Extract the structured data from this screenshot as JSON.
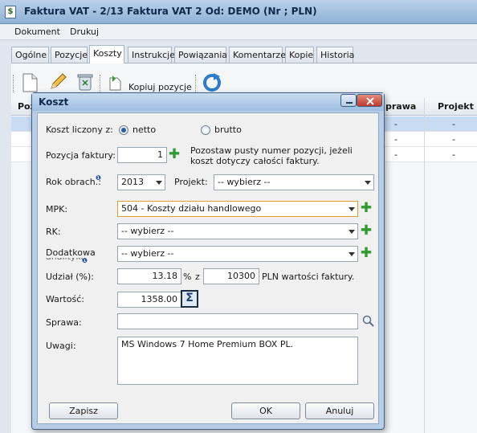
{
  "window": {
    "title": "Faktura VAT - 2/13 Faktura VAT 2 Od: DEMO (Nr ; PLN)"
  },
  "menu": [
    "Dokument",
    "Drukuj"
  ],
  "tabs": [
    "Ogólne",
    "Pozycje",
    "Koszty",
    "Instrukcje",
    "Powiązania",
    "Komentarze",
    "Kopie",
    "Historia"
  ],
  "toolbar": {
    "copy_label": "Kopiuj pozycje"
  },
  "grid": {
    "headers": {
      "first": "Poz",
      "sprawa": "prawa",
      "projekt": "Projekt"
    },
    "rows": [
      {
        "sprawa": "-",
        "projekt": "-"
      },
      {
        "sprawa": "-",
        "projekt": "-"
      },
      {
        "sprawa": "-",
        "projekt": "-"
      }
    ]
  },
  "dialog": {
    "title": "Koszt",
    "cost_basis_label": "Koszt liczony z:",
    "netto_label": "netto",
    "brutto_label": "brutto",
    "position_label": "Pozycja faktury:",
    "position_value": "1",
    "position_hint": "Pozostaw pusty numer pozycji, jeżeli koszt dotyczy całości faktury.",
    "year_label": "Rok obrach.:",
    "year_value": "2013",
    "project_label": "Projekt:",
    "project_value": "-- wybierz --",
    "mpk_label": "MPK:",
    "mpk_value": "504 - Koszty działu handlowego",
    "rk_label": "RK:",
    "rk_value": "-- wybierz --",
    "extra_label": "Dodatkowa",
    "extra_label2": "analityka",
    "extra_value": "-- wybierz --",
    "share_label": "Udział (%):",
    "share_value": "13.18",
    "percent_sign": "%",
    "of_label": "z",
    "total_value": "10300",
    "total_suffix": "PLN wartości faktury.",
    "amount_label": "Wartość:",
    "amount_value": "1358.00",
    "case_label": "Sprawa:",
    "case_value": "",
    "notes_label": "Uwagi:",
    "notes_value": "MS Windows 7 Home Premium BOX PL.",
    "save_button": "Zapisz",
    "ok_button": "OK",
    "cancel_button": "Anuluj"
  },
  "icons": {
    "app": "invoice-icon",
    "new": "new-document-icon",
    "edit": "pencil-icon",
    "delete": "recycle-bin-icon",
    "copy": "copy-icon",
    "refresh": "refresh-icon",
    "search": "magnifier-icon",
    "sum": "sigma-icon",
    "add": "plus-icon"
  },
  "colors": {
    "accent": "#2f9a2f",
    "selection": "#c7dbf3",
    "focus_border": "#e0a22a"
  }
}
